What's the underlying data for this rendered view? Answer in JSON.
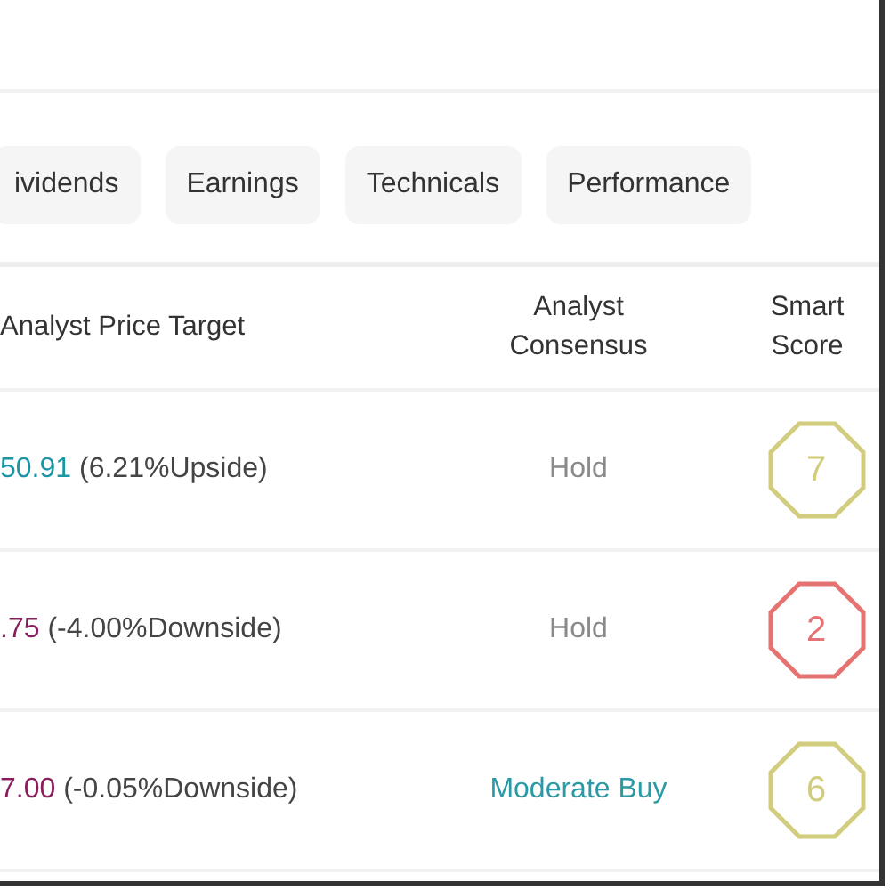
{
  "tabs": [
    {
      "label": "ividends",
      "selected": false
    },
    {
      "label": "Earnings",
      "selected": false
    },
    {
      "label": "Technicals",
      "selected": false
    },
    {
      "label": "Performance",
      "selected": false
    }
  ],
  "table": {
    "columns": [
      "Analyst Price Target",
      "Analyst Consensus",
      "Smart Score"
    ],
    "rows": [
      {
        "price_target": {
          "value": "50.91",
          "change": "(6.21%Upside)",
          "color": "#1a95a3"
        },
        "consensus": {
          "label": "Hold",
          "color": "#8a8a8a"
        },
        "smart_score": {
          "value": "7",
          "color": "#d2cd7e"
        }
      },
      {
        "price_target": {
          "value": ".75",
          "change": "(-4.00%Downside)",
          "color": "#8a1e5c"
        },
        "consensus": {
          "label": "Hold",
          "color": "#8a8a8a"
        },
        "smart_score": {
          "value": "2",
          "color": "#e57373"
        }
      },
      {
        "price_target": {
          "value": "7.00",
          "change": "(-0.05%Downside)",
          "color": "#8a1e5c"
        },
        "consensus": {
          "label": "Moderate Buy",
          "color": "#2a9aa6"
        },
        "smart_score": {
          "value": "6",
          "color": "#d2cd7e"
        }
      }
    ]
  }
}
